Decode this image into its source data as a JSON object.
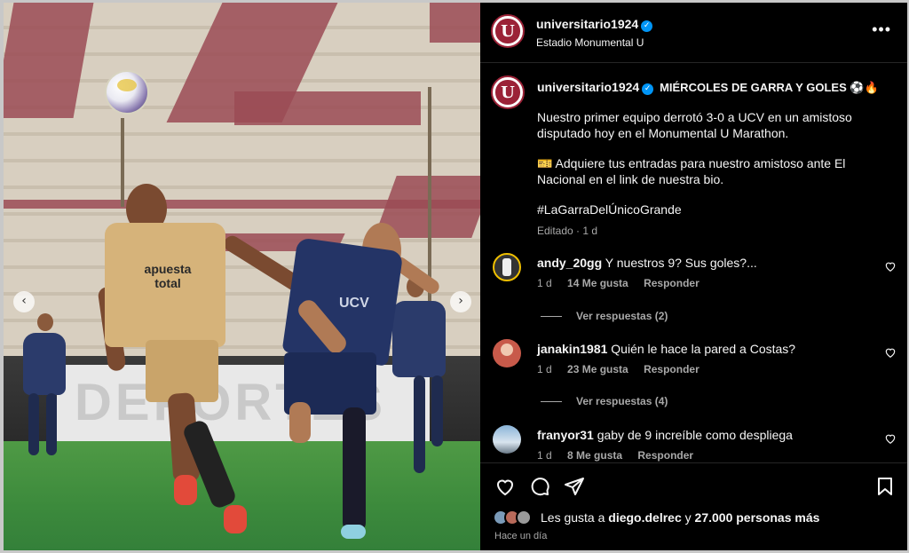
{
  "post": {
    "author": "universitario1924",
    "location": "Estadio Monumental U",
    "avatar_letter": "U",
    "caption_title": "MIÉRCOLES DE GARRA Y GOLES ⚽🔥",
    "caption_p1": "Nuestro primer equipo derrotó 3-0 a UCV en un amistoso disputado hoy en el Monumental U Marathon.",
    "caption_p2": "🎫 Adquiere tus entradas para nuestro amistoso ante El Nacional en el link de nuestra bio.",
    "hashtag": "#LaGarraDelÚnicoGrande",
    "edited": "Editado · 1 d",
    "more_icon": "more-options-icon"
  },
  "photo": {
    "ad_text": "DEPORTES",
    "jersey_sponsor": "apuesta total",
    "rival_jersey": "UCV",
    "prev_glyph": "‹",
    "next_glyph": "›"
  },
  "comments": [
    {
      "user": "andy_20gg",
      "text": "Y nuestros 9? Sus goles?...",
      "age": "1 d",
      "likes": "14 Me gusta",
      "reply": "Responder",
      "view_replies": "Ver respuestas (2)"
    },
    {
      "user": "janakin1981",
      "text": "Quién le hace la pared a Costas?",
      "age": "1 d",
      "likes": "23 Me gusta",
      "reply": "Responder",
      "view_replies": "Ver respuestas (4)"
    },
    {
      "user": "franyor31",
      "text": "gaby de 9 increíble como despliega",
      "age": "1 d",
      "likes": "8 Me gusta",
      "reply": "Responder"
    }
  ],
  "footer": {
    "likes_prefix": "Les gusta a ",
    "likes_user": "diego.delrec",
    "likes_middle": " y ",
    "likes_count": "27.000 personas más",
    "timestamp": "Hace un día"
  },
  "colors": {
    "brand": "#9b2237",
    "verified": "#0095f6",
    "panel_bg": "#000000",
    "muted_text": "#a8a8a8"
  }
}
